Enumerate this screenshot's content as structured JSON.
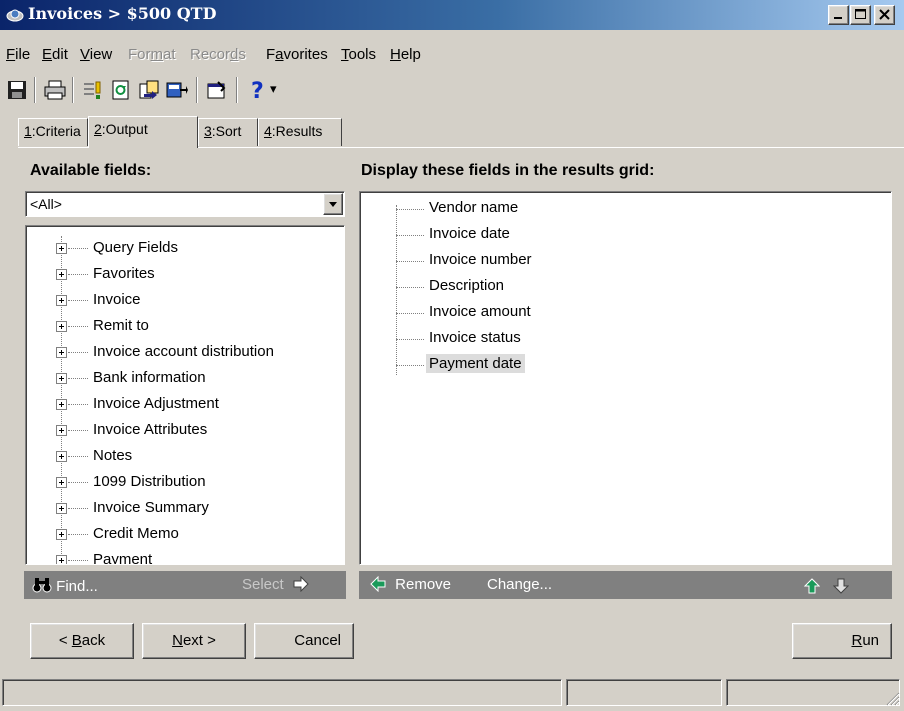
{
  "window": {
    "title": "Invoices > $500 QTD",
    "controls": [
      "minimize",
      "maximize",
      "close"
    ]
  },
  "menu": [
    {
      "label": "File",
      "accel": "F",
      "rest": "ile",
      "enabled": true
    },
    {
      "label": "Edit",
      "accel": "E",
      "rest": "dit",
      "enabled": true
    },
    {
      "label": "View",
      "accel": "V",
      "rest": "iew",
      "enabled": true
    },
    {
      "label": "Format",
      "pre": "For",
      "accel": "m",
      "rest": "at",
      "enabled": false
    },
    {
      "label": "Records",
      "pre": "Recor",
      "accel": "d",
      "rest": "s",
      "enabled": false
    },
    {
      "label": "Favorites",
      "pre": "F",
      "accel": "a",
      "rest": "vorites",
      "enabled": true
    },
    {
      "label": "Tools",
      "accel": "T",
      "rest": "ools",
      "enabled": true
    },
    {
      "label": "Help",
      "accel": "H",
      "rest": "elp",
      "enabled": true
    }
  ],
  "toolbar": {
    "icons": [
      "save-icon",
      "print-icon",
      "criteria-icon",
      "refresh-icon",
      "export-icon",
      "merge-icon",
      "properties-icon",
      "help-icon"
    ],
    "help_dropdown_glyph": "▾"
  },
  "tabs": [
    {
      "num": "1",
      "rest": ":Criteria",
      "active": false
    },
    {
      "num": "2",
      "rest": ":Output",
      "active": true
    },
    {
      "num": "3",
      "rest": ":Sort",
      "active": false
    },
    {
      "num": "4",
      "rest": ":Results",
      "active": false
    }
  ],
  "left_pane": {
    "heading": "Available fields:",
    "filter_value": "<All>",
    "tree_items": [
      "Query Fields",
      "Favorites",
      "Invoice",
      "Remit to",
      "Invoice account distribution",
      "Bank information",
      "Invoice Adjustment",
      "Invoice Attributes",
      "Notes",
      "1099 Distribution",
      "Invoice Summary",
      "Credit Memo",
      "Payment"
    ],
    "find_label": "Find...",
    "select_label": "Select"
  },
  "right_pane": {
    "heading": "Display these fields in the results grid:",
    "fields": [
      "Vendor name",
      "Invoice date",
      "Invoice number",
      "Description",
      "Invoice amount",
      "Invoice status",
      "Payment date"
    ],
    "selected_field": "Payment date",
    "remove_label": "Remove",
    "change_label": "Change..."
  },
  "buttons": {
    "back": {
      "pre": "< ",
      "accel": "B",
      "rest": "ack"
    },
    "next": {
      "accel": "N",
      "rest": "ext >"
    },
    "cancel": "Cancel",
    "run": {
      "accel": "R",
      "rest": "un"
    }
  },
  "colors": {
    "title_gradient_start": "#0a246a",
    "title_gradient_end": "#a6caf0",
    "face": "#d4d0c8",
    "dark_bar": "#808080",
    "arrow_green": "#1a9a5a"
  }
}
